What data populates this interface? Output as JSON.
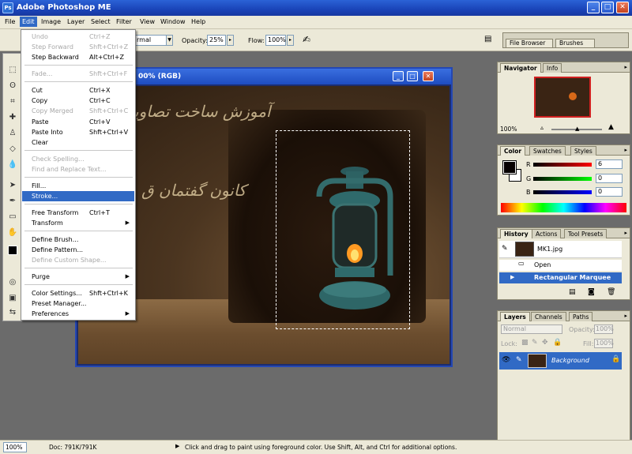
{
  "window": {
    "title": "Adobe Photoshop ME",
    "logo_text": "Ps"
  },
  "menubar": [
    "File",
    "Edit",
    "Image",
    "Layer",
    "Select",
    "Filter",
    "View",
    "Window",
    "Help"
  ],
  "options": {
    "mode_value": "rmal",
    "opacity_label": "Opacity:",
    "opacity_value": "25%",
    "flow_label": "Flow:",
    "flow_value": "100%"
  },
  "palette_well": {
    "tab1": "File Browser",
    "tab2": "Brushes"
  },
  "document": {
    "title_fragment": "00% (RGB)"
  },
  "edit_menu": [
    {
      "label": "Undo",
      "shortcut": "Ctrl+Z",
      "disabled": true
    },
    {
      "label": "Step Forward",
      "shortcut": "Shft+Ctrl+Z",
      "disabled": true
    },
    {
      "label": "Step Backward",
      "shortcut": "Alt+Ctrl+Z",
      "disabled": false
    },
    {
      "label": "Fade...",
      "shortcut": "Shft+Ctrl+F",
      "disabled": true
    },
    {
      "label": "Cut",
      "shortcut": "Ctrl+X",
      "disabled": false
    },
    {
      "label": "Copy",
      "shortcut": "Ctrl+C",
      "disabled": false
    },
    {
      "label": "Copy Merged",
      "shortcut": "Shft+Ctrl+C",
      "disabled": true
    },
    {
      "label": "Paste",
      "shortcut": "Ctrl+V",
      "disabled": false
    },
    {
      "label": "Paste Into",
      "shortcut": "Shft+Ctrl+V",
      "disabled": false
    },
    {
      "label": "Clear",
      "shortcut": "",
      "disabled": false
    },
    {
      "label": "Check Spelling...",
      "shortcut": "",
      "disabled": true
    },
    {
      "label": "Find and Replace Text...",
      "shortcut": "",
      "disabled": true
    },
    {
      "label": "Fill...",
      "shortcut": "",
      "disabled": false
    },
    {
      "label": "Stroke...",
      "shortcut": "",
      "disabled": false,
      "highlight": true
    },
    {
      "label": "Free Transform",
      "shortcut": "Ctrl+T",
      "disabled": false
    },
    {
      "label": "Transform",
      "shortcut": "",
      "disabled": false,
      "submenu": true
    },
    {
      "label": "Define Brush...",
      "shortcut": "",
      "disabled": false
    },
    {
      "label": "Define Pattern...",
      "shortcut": "",
      "disabled": false
    },
    {
      "label": "Define Custom Shape...",
      "shortcut": "",
      "disabled": true
    },
    {
      "label": "Purge",
      "shortcut": "",
      "disabled": false,
      "submenu": true
    },
    {
      "label": "Color Settings...",
      "shortcut": "Shft+Ctrl+K",
      "disabled": false
    },
    {
      "label": "Preset Manager...",
      "shortcut": "",
      "disabled": false
    },
    {
      "label": "Preferences",
      "shortcut": "",
      "disabled": false,
      "submenu": true
    }
  ],
  "canvas_text": {
    "line1": "آموزش ساخت تصاویر",
    "line2": "کانون گفتمان ق"
  },
  "navigator": {
    "tab_active": "Navigator",
    "tab2": "Info",
    "zoom": "100%"
  },
  "color_panel": {
    "tab_active": "Color",
    "tab2": "Swatches",
    "tab3": "Styles",
    "r_label": "R",
    "r_value": "6",
    "g_label": "G",
    "g_value": "0",
    "b_label": "B",
    "b_value": "0"
  },
  "history": {
    "tab_active": "History",
    "tab2": "Actions",
    "tab3": "Tool Presets",
    "snapshot": "MK1.jpg",
    "items": [
      "Open",
      "Rectangular Marquee"
    ]
  },
  "layers": {
    "tab_active": "Layers",
    "tab2": "Channels",
    "tab3": "Paths",
    "blend_mode": "Normal",
    "opacity_label": "Opacity:",
    "opacity_value": "100%",
    "lock_label": "Lock:",
    "fill_label": "Fill:",
    "fill_value": "100%",
    "layer_name": "Background"
  },
  "status": {
    "zoom": "100%",
    "doc": "Doc: 791K/791K",
    "hint": "Click and drag to paint using foreground color.  Use Shift, Alt, and Ctrl for additional options."
  },
  "colors": {
    "accent": "#316ac5",
    "title_blue": "#1a44b8",
    "panel_bg": "#ece9d8"
  }
}
